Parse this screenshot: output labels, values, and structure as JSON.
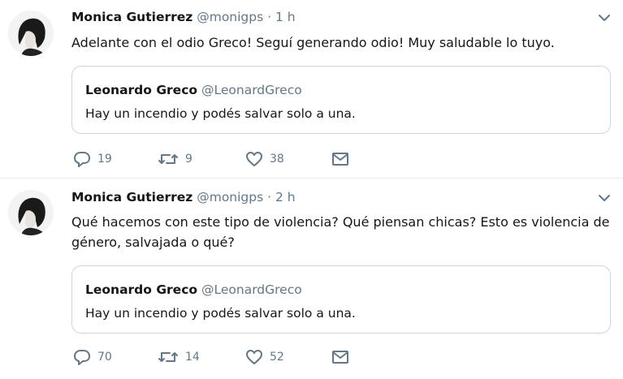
{
  "tweets": [
    {
      "author_name": "Monica Gutierrez",
      "author_handle": "@monigps",
      "separator": "·",
      "time": "1 h",
      "text": "Adelante con el odio Greco! Seguí generando odio! Muy saludable lo tuyo.",
      "quote": {
        "author_name": "Leonardo Greco",
        "author_handle": "@LeonardGreco",
        "text": "Hay un incendio y podés salvar solo a una."
      },
      "replies": "19",
      "retweets": "9",
      "likes": "38"
    },
    {
      "author_name": "Monica Gutierrez",
      "author_handle": "@monigps",
      "separator": "·",
      "time": "2 h",
      "text": "Qué hacemos con este tipo de violencia? Qué piensan chicas? Esto es violencia de género, salvajada o qué?",
      "quote": {
        "author_name": "Leonardo Greco",
        "author_handle": "@LeonardGreco",
        "text": "Hay un incendio y podés salvar solo a una."
      },
      "replies": "70",
      "retweets": "14",
      "likes": "52"
    }
  ],
  "icons": {
    "reply": "reply-icon",
    "retweet": "retweet-icon",
    "like": "heart-icon",
    "dm": "envelope-icon",
    "menu": "chevron-down-icon"
  },
  "colors": {
    "text": "#14171a",
    "secondary": "#657786",
    "border": "#ccd6dd"
  }
}
